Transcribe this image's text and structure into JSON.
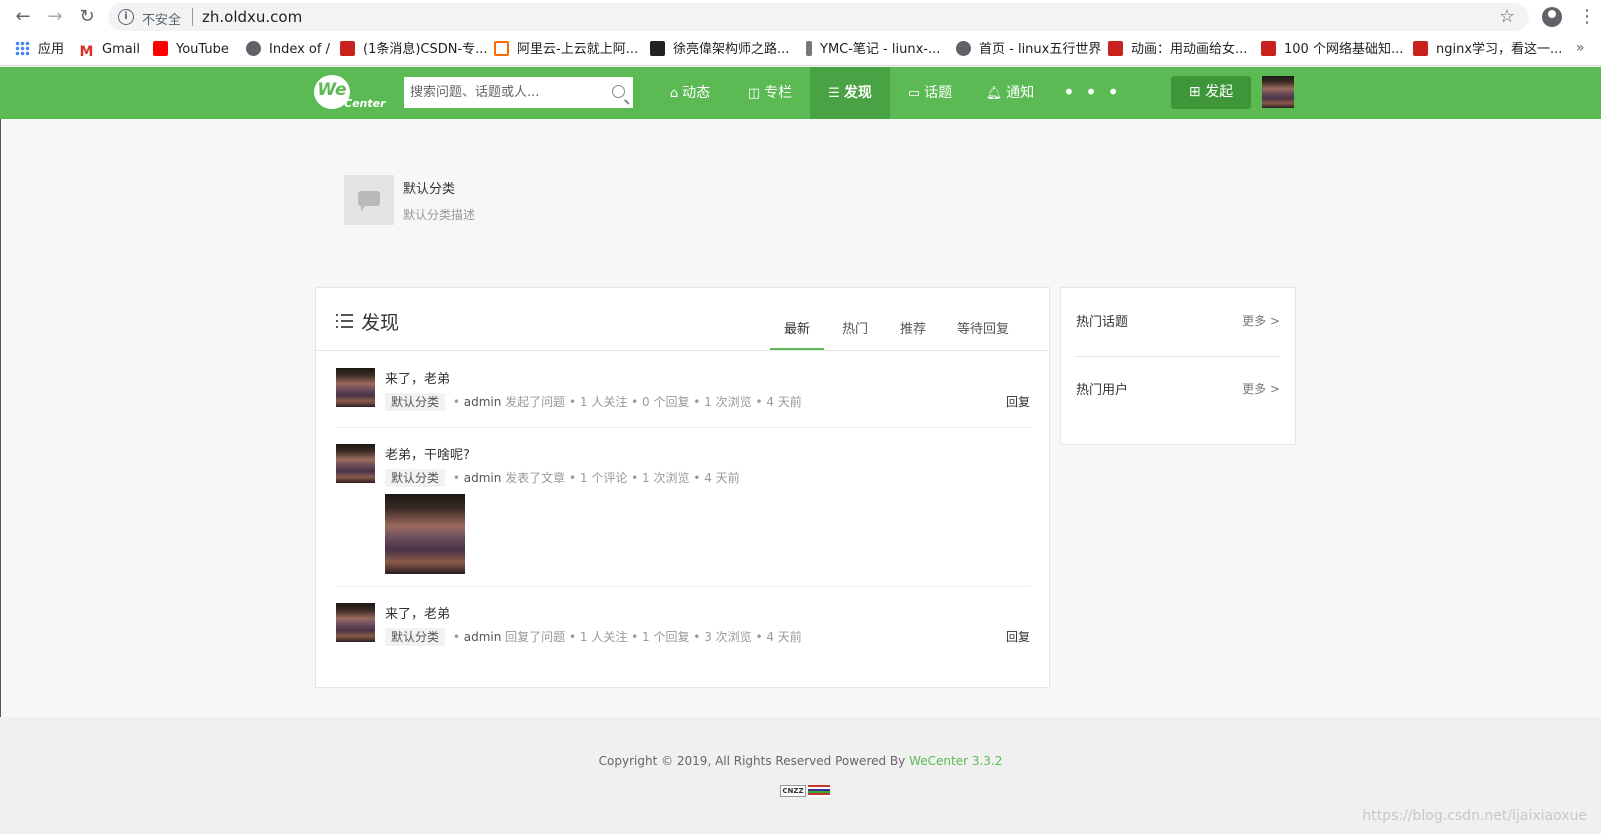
{
  "browser": {
    "insecure_label": "不安全",
    "url": "zh.oldxu.com",
    "bookmarks": [
      {
        "label": "应用",
        "color": "#4285f4"
      },
      {
        "label": "Gmail",
        "color": "#d93025"
      },
      {
        "label": "YouTube",
        "color": "#ff0000"
      },
      {
        "label": "Index of /",
        "color": "#5f6368"
      },
      {
        "label": "(1条消息)CSDN-专...",
        "color": "#c9211e"
      },
      {
        "label": "阿里云-上云就上阿...",
        "color": "#ff6a00"
      },
      {
        "label": "徐亮偉架构师之路...",
        "color": "#222222"
      },
      {
        "label": "YMC-笔记 - liunx-...",
        "color": "#777777"
      },
      {
        "label": "首页 - linux五行世界",
        "color": "#5f6368"
      },
      {
        "label": "动画：用动画给女...",
        "color": "#c9211e"
      },
      {
        "label": "100 个网络基础知...",
        "color": "#c9211e"
      },
      {
        "label": "nginx学习，看这一...",
        "color": "#c9211e"
      }
    ]
  },
  "header": {
    "logo_we": "We",
    "logo_center": "Center",
    "search_placeholder": "搜索问题、话题或人...",
    "nav": [
      {
        "label": "动态",
        "icon": "home-icon",
        "glyph": "⌂"
      },
      {
        "label": "专栏",
        "icon": "columns-icon",
        "glyph": "◫"
      },
      {
        "label": "发现",
        "icon": "list-icon",
        "glyph": "☰",
        "active": true
      },
      {
        "label": "话题",
        "icon": "topic-icon",
        "glyph": "▭"
      },
      {
        "label": "通知",
        "icon": "bell-icon",
        "glyph": "♫"
      }
    ],
    "more_dots": "• • •",
    "publish_label": "发起",
    "brand_color": "#5cba55"
  },
  "category": {
    "title": "默认分类",
    "description": "默认分类描述"
  },
  "main": {
    "title": "发现",
    "tabs": [
      "最新",
      "热门",
      "推荐",
      "等待回复"
    ],
    "active_tab": "最新",
    "items": [
      {
        "title": "来了，老弟",
        "tag": "默认分类",
        "user": "admin",
        "meta": "发起了问题 • 1 人关注 • 0 个回复 • 1 次浏览 • 4 天前",
        "reply": "回复"
      },
      {
        "title": "老弟，干啥呢?",
        "tag": "默认分类",
        "user": "admin",
        "meta": "发表了文章 • 1 个评论 • 1 次浏览 • 4 天前",
        "reply": ""
      },
      {
        "title": "来了，老弟",
        "tag": "默认分类",
        "user": "admin",
        "meta": "回复了问题 • 1 人关注 • 1 个回复 • 3 次浏览 • 4 天前",
        "reply": "回复"
      }
    ]
  },
  "sidebar": {
    "hot_topics": "热门话题",
    "hot_users": "热门用户",
    "more": "更多 >"
  },
  "footer": {
    "copyright": "Copyright © 2019, All Rights Reserved Powered By ",
    "powered_link": "WeCenter 3.3.2",
    "cnzz": "CNZZ"
  },
  "watermark": "https://blog.csdn.net/ljaixiaoxue"
}
